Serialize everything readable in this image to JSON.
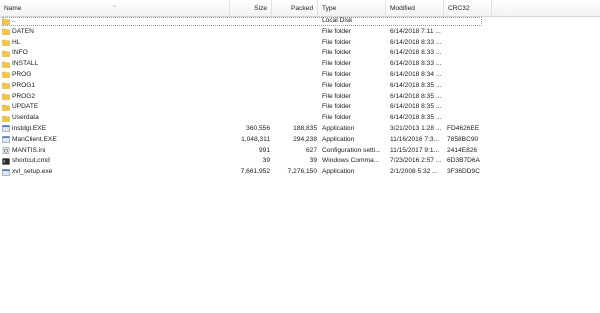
{
  "columns": {
    "name": "Name",
    "size": "Size",
    "packed": "Packed",
    "type": "Type",
    "modified": "Modified",
    "crc": "CRC32"
  },
  "colors": {
    "folder": "#f2c447",
    "folder_dark": "#d9a520",
    "file": "#dfe6ee"
  },
  "rows": [
    {
      "name": "..",
      "size": "",
      "packed": "",
      "type": "Local Disk",
      "modified": "",
      "crc": "",
      "icon": "folder-up-icon"
    },
    {
      "name": "DATEN",
      "size": "",
      "packed": "",
      "type": "File folder",
      "modified": "6/14/2018 7:11 ...",
      "crc": "",
      "icon": "folder-icon"
    },
    {
      "name": "HL",
      "size": "",
      "packed": "",
      "type": "File folder",
      "modified": "6/14/2018 8:33 ...",
      "crc": "",
      "icon": "folder-icon"
    },
    {
      "name": "INFO",
      "size": "",
      "packed": "",
      "type": "File folder",
      "modified": "6/14/2018 8:33 ...",
      "crc": "",
      "icon": "folder-icon"
    },
    {
      "name": "INSTALL",
      "size": "",
      "packed": "",
      "type": "File folder",
      "modified": "6/14/2018 8:33 ...",
      "crc": "",
      "icon": "folder-icon"
    },
    {
      "name": "PROG",
      "size": "",
      "packed": "",
      "type": "File folder",
      "modified": "6/14/2018 8:34 ...",
      "crc": "",
      "icon": "folder-icon"
    },
    {
      "name": "PROG1",
      "size": "",
      "packed": "",
      "type": "File folder",
      "modified": "6/14/2018 8:35 ...",
      "crc": "",
      "icon": "folder-icon"
    },
    {
      "name": "PROG2",
      "size": "",
      "packed": "",
      "type": "File folder",
      "modified": "6/14/2018 8:35 ...",
      "crc": "",
      "icon": "folder-icon"
    },
    {
      "name": "UPDATE",
      "size": "",
      "packed": "",
      "type": "File folder",
      "modified": "6/14/2018 8:35 ...",
      "crc": "",
      "icon": "folder-icon"
    },
    {
      "name": "Userdata",
      "size": "",
      "packed": "",
      "type": "File folder",
      "modified": "6/14/2018 8:35 ...",
      "crc": "",
      "icon": "folder-icon"
    },
    {
      "name": "instdgl.EXE",
      "size": "360,556",
      "packed": "188,835",
      "type": "Application",
      "modified": "3/21/2013 1:28 ...",
      "crc": "FD4626EE",
      "icon": "application-icon"
    },
    {
      "name": "ManClient.EXE",
      "size": "1,048,311",
      "packed": "294,238",
      "type": "Application",
      "modified": "11/16/2016 7:3...",
      "crc": "7858BC90",
      "icon": "application-icon"
    },
    {
      "name": "MANTIS.ini",
      "size": "991",
      "packed": "627",
      "type": "Configuration setti...",
      "modified": "11/15/2017 9:1...",
      "crc": "2414E826",
      "icon": "settings-file-icon"
    },
    {
      "name": "shortcut.cmd",
      "size": "39",
      "packed": "39",
      "type": "Windows Comma...",
      "modified": "7/23/2016 2:57 ...",
      "crc": "6D3B7D6A",
      "icon": "script-file-icon"
    },
    {
      "name": "xvl_setup.exe",
      "size": "7,661,952",
      "packed": "7,276,150",
      "type": "Application",
      "modified": "2/1/2008 5:32 ...",
      "crc": "3F36DD9C",
      "icon": "application-icon"
    }
  ]
}
